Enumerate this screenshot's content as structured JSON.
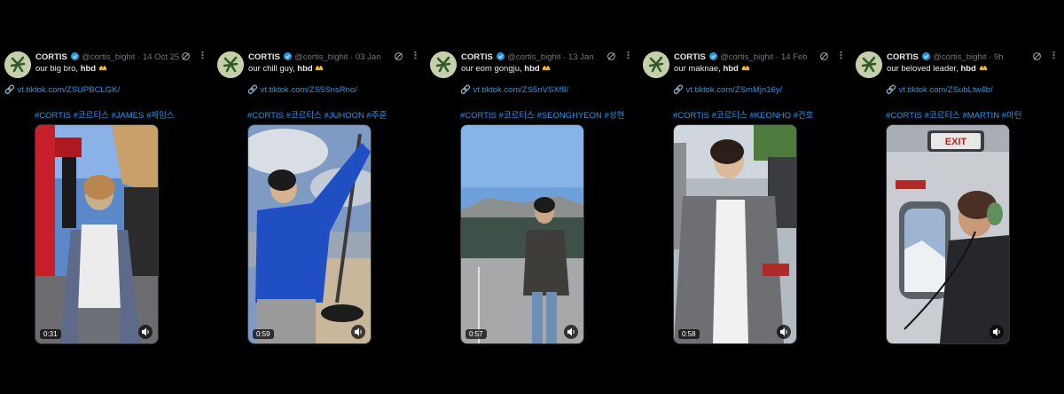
{
  "account": {
    "name": "CORTIS",
    "handle": "@cortis_bighit"
  },
  "colors": {
    "background": "#000000",
    "link": "#1d9bf0",
    "muted": "#71767b",
    "verified": "#1d9bf0"
  },
  "tweets": [
    {
      "date": "14 Oct 25",
      "text_prefix": "our big bro, ",
      "text_bold": "hbd",
      "link": "vt.tiktok.com/ZSUPBCLGK/",
      "hashtags": "#CORTIS #코르티스 #JAMES #제임스",
      "duration": "0:31"
    },
    {
      "date": "03 Jan",
      "text_prefix": "our chill guy, ",
      "text_bold": "hbd",
      "link": "vt.tiktok.com/ZS5SnsRno/",
      "hashtags": "#CORTIS #코르티스 #JUHOON #주훈",
      "duration": "0:59"
    },
    {
      "date": "13 Jan",
      "text_prefix": "our eom gongju, ",
      "text_bold": "hbd",
      "link": "vt.tiktok.com/ZS5nVSXf8/",
      "hashtags": "#CORTIS #코르티스 #SEONGHYEON #성현",
      "duration": "0:57"
    },
    {
      "date": "14 Feb",
      "text_prefix": "our maknae, ",
      "text_bold": "hbd",
      "link": "vt.tiktok.com/ZSmMjn16y/",
      "hashtags": "#CORTIS #코르티스 #KEONHO #건호",
      "duration": "0:58"
    },
    {
      "date": "9h",
      "text_prefix": "our beloved leader, ",
      "text_bold": "hbd",
      "link": "vt.tiktok.com/ZSubLtw4b/",
      "hashtags": "#CORTIS #코르티스 #MARTIN #마틴",
      "duration": ""
    }
  ],
  "media": [
    {
      "exit_sign": ""
    },
    {
      "exit_sign": ""
    },
    {
      "exit_sign": ""
    },
    {
      "exit_sign": ""
    },
    {
      "exit_sign": "EXIT"
    }
  ],
  "icons": {
    "verified": "verified-badge-icon",
    "grok": "grok-icon",
    "more": "more-icon",
    "link": "link-icon",
    "volume": "volume-icon",
    "emoji": "hands-emoji-icon"
  },
  "symbols": {
    "more": "⋮",
    "sep": "·",
    "link": "🔗"
  }
}
